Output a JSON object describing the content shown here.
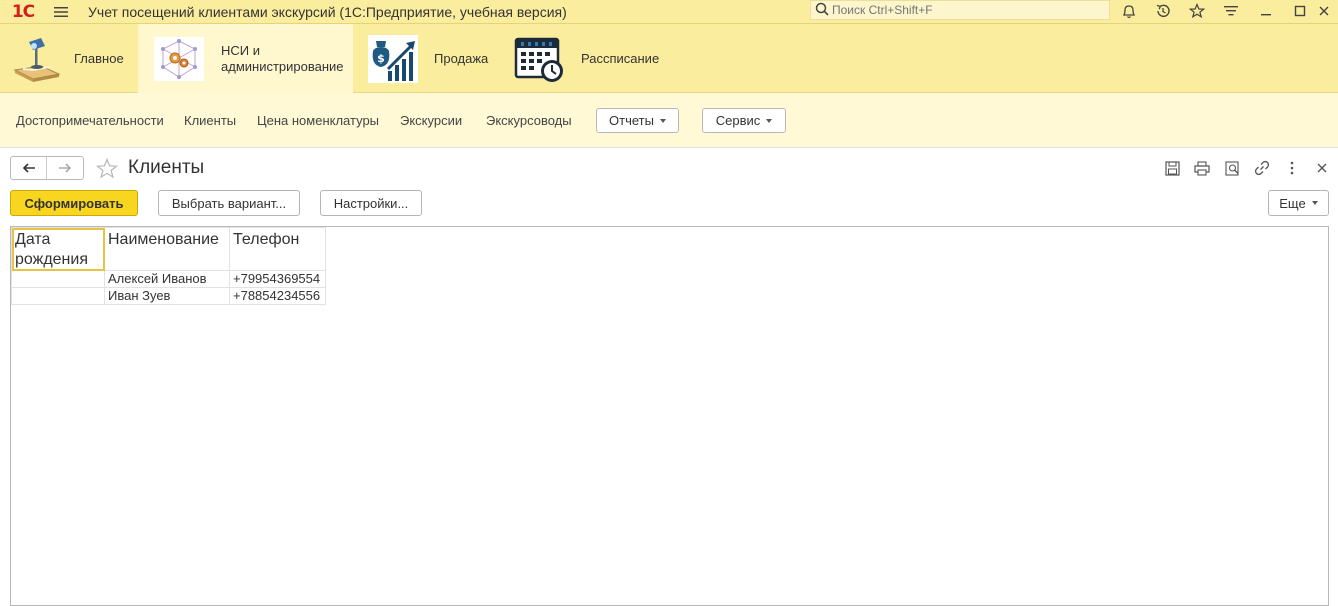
{
  "titlebar": {
    "logo": "1С",
    "title": "Учет посещений клиентами экскурсий  (1С:Предприятие, учебная версия)",
    "search_placeholder": "Поиск Ctrl+Shift+F",
    "icons": [
      "bell-icon",
      "history-icon",
      "star-icon",
      "filter-icon",
      "minimize-icon",
      "maximize-icon",
      "close-icon"
    ]
  },
  "sections": [
    {
      "label": "Главное",
      "icon": "desk-lamp-icon"
    },
    {
      "label_line1": "НСИ и",
      "label_line2": "администрирование",
      "icon": "gears-network-icon",
      "active": true
    },
    {
      "label": "Продажа",
      "icon": "money-growth-icon"
    },
    {
      "label": "Рассписание",
      "icon": "calendar-clock-icon"
    }
  ],
  "nav": {
    "links": [
      "Достопримечательности",
      "Клиенты",
      "Цена номенклатуры",
      "Экскурсии",
      "Экскурсоводы"
    ],
    "reports": "Отчеты",
    "service": "Сервис"
  },
  "form": {
    "title": "Клиенты",
    "generate": "Сформировать",
    "choose_variant": "Выбрать вариант...",
    "settings": "Настройки...",
    "more": "Еще"
  },
  "report": {
    "headers": [
      "Дата рождения",
      "Наименование",
      "Телефон"
    ],
    "header_line1": "Дата",
    "header_line2": "рождения",
    "rows": [
      {
        "birth": "",
        "name": "Алексей Иванов",
        "phone": "+79954369554"
      },
      {
        "birth": "",
        "name": "Иван Зуев",
        "phone": "+78854234556"
      }
    ]
  },
  "colors": {
    "accent": "#f8d51e",
    "panel": "#fbed9e",
    "nav_panel": "#fff9d6",
    "logo_red": "#d41e1e"
  }
}
